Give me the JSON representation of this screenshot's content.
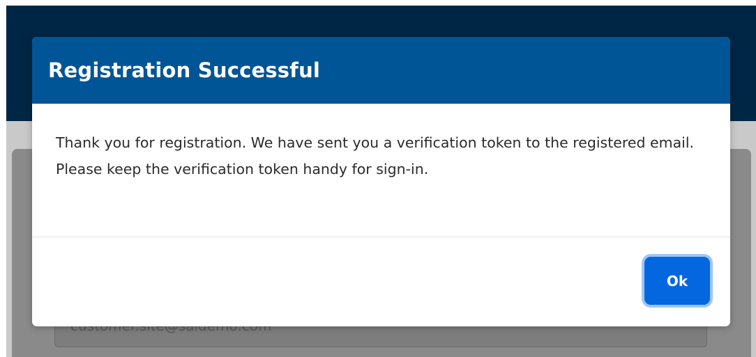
{
  "modal": {
    "title": "Registration Successful",
    "message": "Thank you for registration. We have sent you a verification token to the registered email. Please keep the verification token handy for sign-in.",
    "ok_label": "Ok"
  },
  "background_form": {
    "email_value": "customer.site@saldemo.com"
  },
  "colors": {
    "header_band": "#002645",
    "modal_header": "#005596",
    "ok_button": "#0467e0",
    "overlay": "#c9c9c9"
  }
}
